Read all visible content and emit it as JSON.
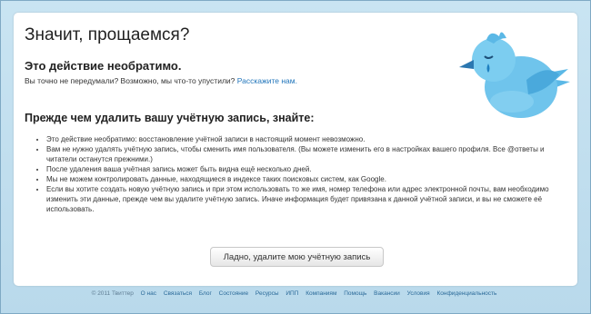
{
  "page": {
    "title": "Значит, прощаемся?"
  },
  "warning": {
    "title": "Это действие необратимо.",
    "subtitle": "Вы точно не передумали? Возможно, мы что-то упустили?",
    "link_label": "Расскажите нам."
  },
  "info": {
    "title": "Прежде чем удалить вашу учётную запись, знайте:",
    "items": [
      "Это действие необратимо: восстановление учётной записи в настоящий момент невозможно.",
      "Вам не нужно удалять учётную запись, чтобы сменить имя пользователя. (Вы можете изменить его в настройках вашего профиля. Все @ответы и читатели останутся прежними.)",
      "После удаления ваша учётная запись может быть видна ещё несколько дней.",
      "Мы не можем контролировать данные, находящиеся в индексе таких поисковых систем, как Google.",
      "Если вы хотите создать новую учётную запись и при этом использовать то же имя, номер телефона или адрес электронной почты, вам необходимо изменить эти данные, прежде чем вы удалите учётную запись. Иначе информация будет привязана к данной учётной записи, и вы не сможете её использовать."
    ]
  },
  "actions": {
    "delete_label": "Ладно, удалите мою учётную запись"
  },
  "footer": {
    "copyright": "© 2011 Твиттер",
    "links": [
      "О нас",
      "Связаться",
      "Блог",
      "Состояние",
      "Ресурсы",
      "ИПП",
      "Компаниям",
      "Помощь",
      "Вакансии",
      "Условия",
      "Конфиденциальность"
    ]
  },
  "icons": {
    "mascot": "sad-twitter-bird-icon"
  },
  "colors": {
    "background": "#c0deed",
    "link": "#2276bb",
    "bird": "#6fc4ec"
  }
}
